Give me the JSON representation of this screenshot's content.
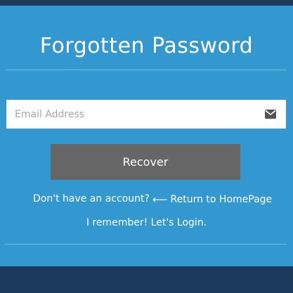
{
  "form": {
    "title": "Forgotten Password",
    "email_placeholder": "Email Address",
    "email_icon": "envelope-icon",
    "recover_label": "Recover"
  },
  "links": {
    "signup": "Don't have an account?",
    "home_arrow": "⟵",
    "home": "Return to HomePage",
    "login": "I remember! Let's Login."
  },
  "colors": {
    "page_background": "#1c3a5b",
    "panel": "#3498d0",
    "button": "#666666",
    "text": "#ffffff",
    "placeholder": "#a7a7a7"
  }
}
